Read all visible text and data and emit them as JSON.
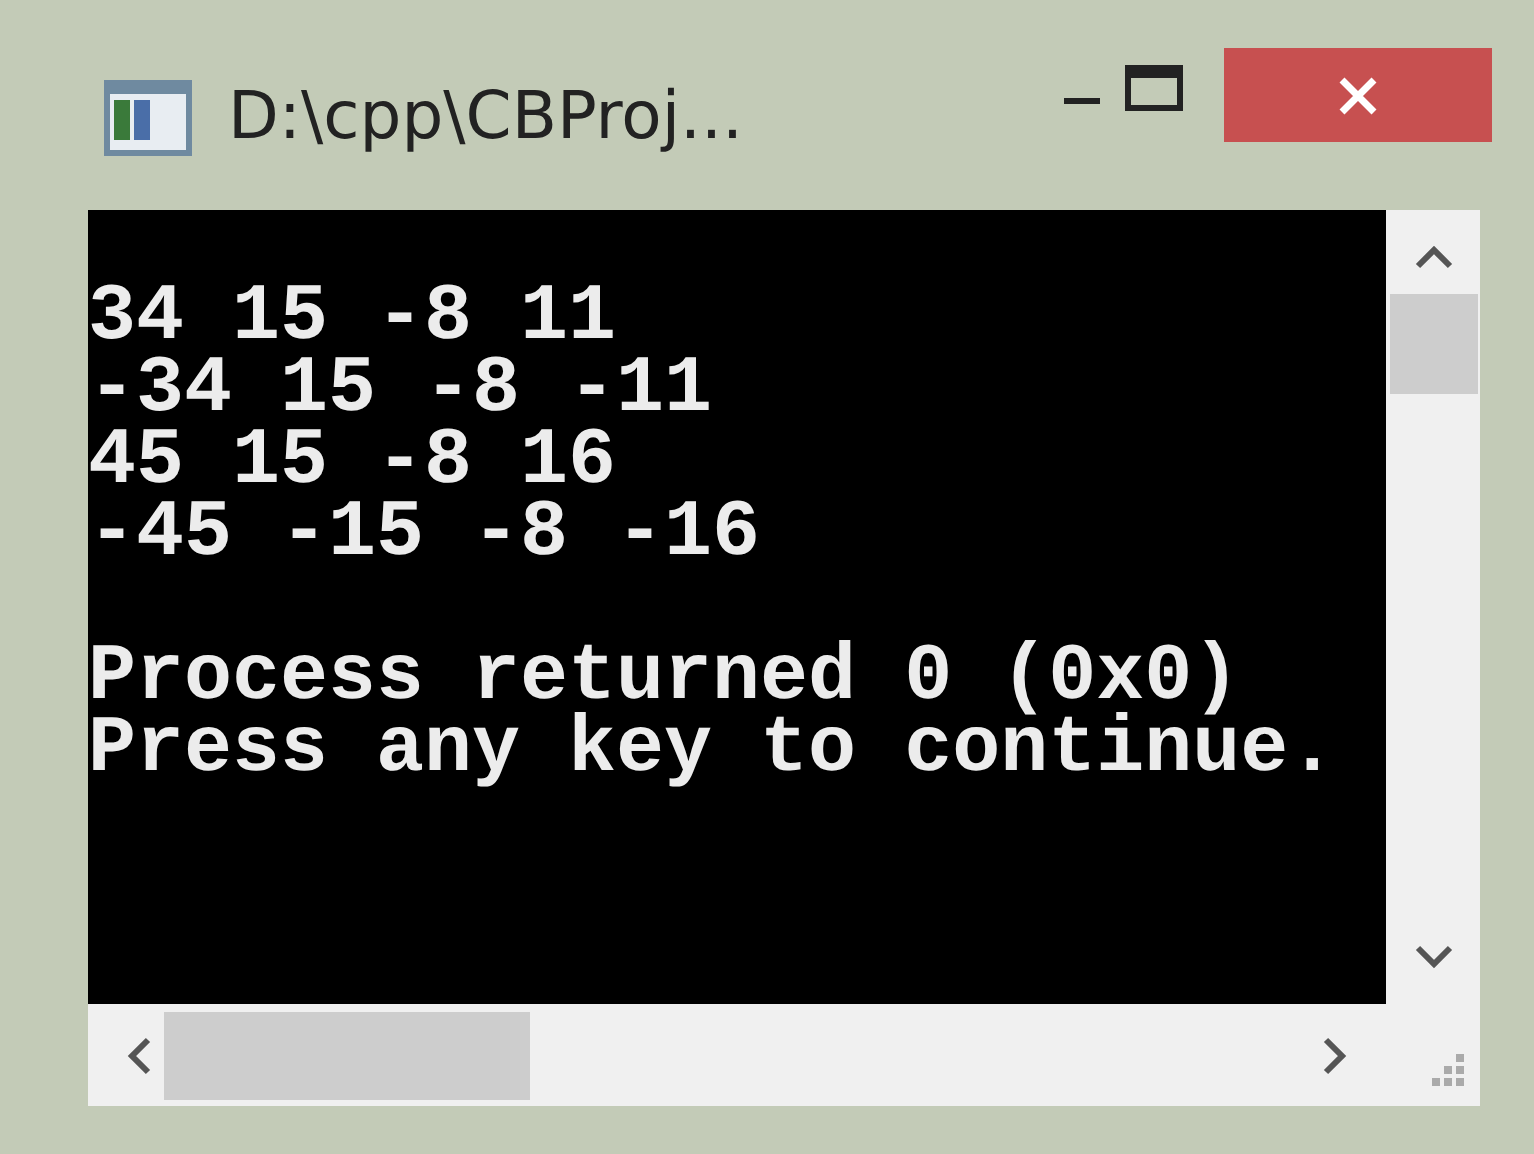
{
  "window": {
    "title": "D:\\cpp\\CBProj..."
  },
  "console": {
    "blocks": [
      {
        "lines": [
          "34 15 -8 11",
          "-34 15 -8 -11",
          "45 15 -8 16",
          "-45 -15 -8 -16"
        ]
      },
      {
        "lines": [
          "Process returned 0 (0x0)",
          "Press any key to continue."
        ]
      }
    ]
  }
}
